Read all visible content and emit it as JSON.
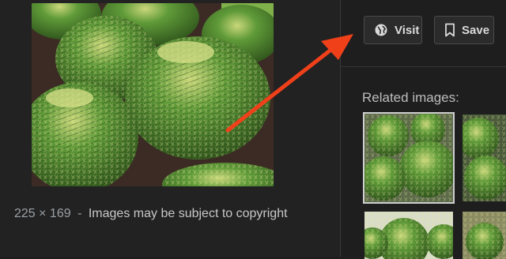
{
  "image_info": {
    "dimensions": "225 × 169",
    "separator": "-",
    "copyright_note": "Images may be subject to copyright"
  },
  "actions": {
    "visit_label": "Visit",
    "save_label": "Save"
  },
  "related": {
    "heading": "Related images:"
  },
  "colors": {
    "background": "#1f1f1f",
    "arrow": "#f0401a",
    "cactus": "#4f8a2f",
    "spine": "#e9ef9a"
  },
  "icons": [
    "globe-icon",
    "bookmark-icon"
  ]
}
